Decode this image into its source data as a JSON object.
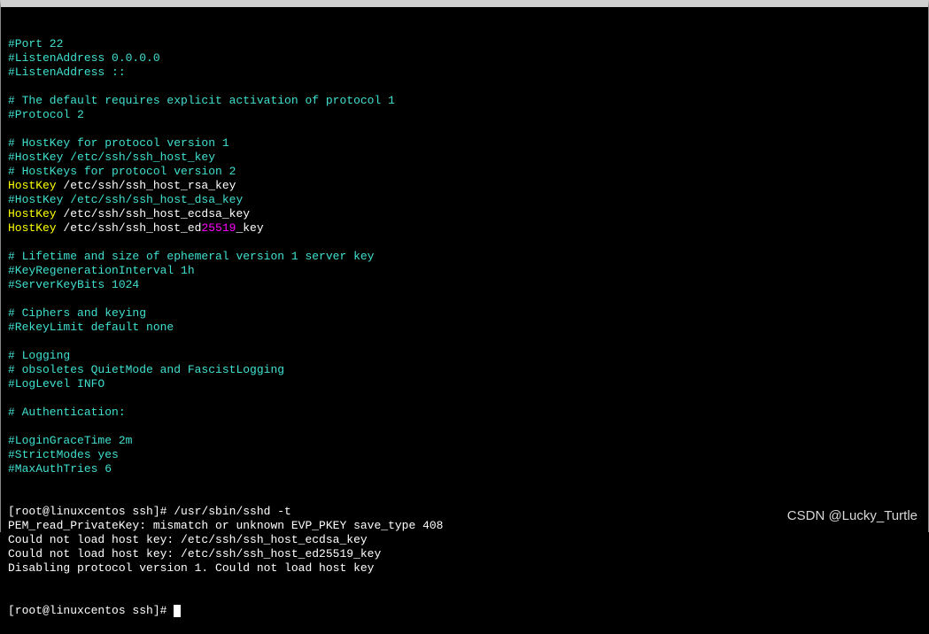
{
  "config_lines": [
    {
      "segments": [
        {
          "text": "#Port 22",
          "cls": "cyan"
        }
      ]
    },
    {
      "segments": [
        {
          "text": "#ListenAddress 0.0.0.0",
          "cls": "cyan"
        }
      ]
    },
    {
      "segments": [
        {
          "text": "#ListenAddress ::",
          "cls": "cyan"
        }
      ]
    },
    {
      "segments": []
    },
    {
      "segments": [
        {
          "text": "# The default requires explicit activation of protocol 1",
          "cls": "cyan"
        }
      ]
    },
    {
      "segments": [
        {
          "text": "#Protocol 2",
          "cls": "cyan"
        }
      ]
    },
    {
      "segments": []
    },
    {
      "segments": [
        {
          "text": "# HostKey for protocol version 1",
          "cls": "cyan"
        }
      ]
    },
    {
      "segments": [
        {
          "text": "#HostKey /etc/ssh/ssh_host_key",
          "cls": "cyan"
        }
      ]
    },
    {
      "segments": [
        {
          "text": "# HostKeys for protocol version 2",
          "cls": "cyan"
        }
      ]
    },
    {
      "segments": [
        {
          "text": "HostKey",
          "cls": "yellow"
        },
        {
          "text": " /etc/ssh/ssh_host_rsa_key",
          "cls": "white"
        }
      ]
    },
    {
      "segments": [
        {
          "text": "#HostKey /etc/ssh/ssh_host_dsa_key",
          "cls": "cyan"
        }
      ]
    },
    {
      "segments": [
        {
          "text": "HostKey",
          "cls": "yellow"
        },
        {
          "text": " /etc/ssh/ssh_host_ecdsa_key",
          "cls": "white"
        }
      ]
    },
    {
      "segments": [
        {
          "text": "HostKey",
          "cls": "yellow"
        },
        {
          "text": " /etc/ssh/ssh_host_ed",
          "cls": "white"
        },
        {
          "text": "25519",
          "cls": "magenta"
        },
        {
          "text": "_key",
          "cls": "white"
        }
      ]
    },
    {
      "segments": []
    },
    {
      "segments": [
        {
          "text": "# Lifetime and size of ephemeral version 1 server key",
          "cls": "cyan"
        }
      ]
    },
    {
      "segments": [
        {
          "text": "#KeyRegenerationInterval 1h",
          "cls": "cyan"
        }
      ]
    },
    {
      "segments": [
        {
          "text": "#ServerKeyBits 1024",
          "cls": "cyan"
        }
      ]
    },
    {
      "segments": []
    },
    {
      "segments": [
        {
          "text": "# Ciphers and keying",
          "cls": "cyan"
        }
      ]
    },
    {
      "segments": [
        {
          "text": "#RekeyLimit default none",
          "cls": "cyan"
        }
      ]
    },
    {
      "segments": []
    },
    {
      "segments": [
        {
          "text": "# Logging",
          "cls": "cyan"
        }
      ]
    },
    {
      "segments": [
        {
          "text": "# obsoletes QuietMode and FascistLogging",
          "cls": "cyan"
        }
      ]
    },
    {
      "segments": [
        {
          "text": "#LogLevel INFO",
          "cls": "cyan"
        }
      ]
    },
    {
      "segments": []
    },
    {
      "segments": [
        {
          "text": "# Authentication:",
          "cls": "cyan"
        }
      ]
    },
    {
      "segments": []
    },
    {
      "segments": [
        {
          "text": "#LoginGraceTime 2m",
          "cls": "cyan"
        }
      ]
    },
    {
      "segments": [
        {
          "text": "#StrictModes yes",
          "cls": "cyan"
        }
      ]
    },
    {
      "segments": [
        {
          "text": "#MaxAuthTries 6",
          "cls": "cyan"
        }
      ]
    }
  ],
  "output_lines": [
    "[root@linuxcentos ssh]# /usr/sbin/sshd -t",
    "PEM_read_PrivateKey: mismatch or unknown EVP_PKEY save_type 408",
    "Could not load host key: /etc/ssh/ssh_host_ecdsa_key",
    "Could not load host key: /etc/ssh/ssh_host_ed25519_key",
    "Disabling protocol version 1. Could not load host key"
  ],
  "prompt": "[root@linuxcentos ssh]# ",
  "watermark": "CSDN @Lucky_Turtle"
}
